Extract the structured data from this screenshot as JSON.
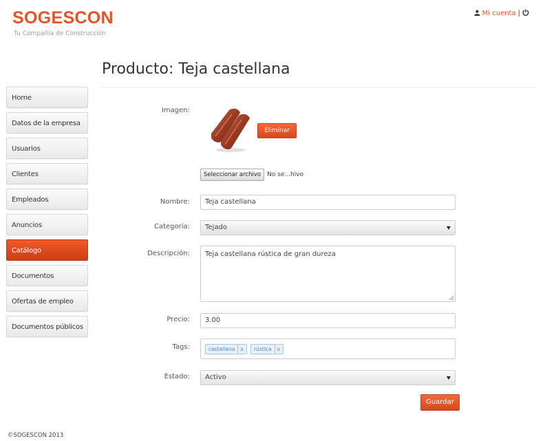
{
  "header": {
    "brand_name": "SOGESCON",
    "brand_tagline": "Tu Compañía de Construcción",
    "account_link": "Mi cuenta",
    "separator": "|"
  },
  "page": {
    "title": "Producto: Teja castellana"
  },
  "sidebar": {
    "items": [
      {
        "label": "Home",
        "active": false
      },
      {
        "label": "Datos de la empresa",
        "active": false
      },
      {
        "label": "Usuarios",
        "active": false
      },
      {
        "label": "Clientes",
        "active": false
      },
      {
        "label": "Empleados",
        "active": false
      },
      {
        "label": "Anuncios",
        "active": false
      },
      {
        "label": "Catálogo",
        "active": true
      },
      {
        "label": "Documentos",
        "active": false
      },
      {
        "label": "Ofertas de empleo",
        "active": false
      },
      {
        "label": "Documentos públicos",
        "active": false
      }
    ]
  },
  "form": {
    "image_label": "Imagen:",
    "delete_button": "Eliminar",
    "file_button": "Seleccionar archivo",
    "file_status": "No se...hivo",
    "name_label": "Nombre:",
    "name_value": "Teja castellana",
    "category_label": "Categoría:",
    "category_value": "Tejado",
    "description_label": "Descripción:",
    "description_value": "Teja castellana rústica de gran dureza",
    "price_label": "Precio:",
    "price_value": "3.00",
    "tags_label": "Tags:",
    "tags": [
      "castellana",
      "rústica"
    ],
    "tag_remove": "x",
    "status_label": "Estado:",
    "status_value": "Activo",
    "save_button": "Guardar"
  },
  "footer": {
    "copyright": "©SOGESCON 2013"
  },
  "colors": {
    "accent": "#e5532a",
    "active_nav": "#dd4a1b"
  },
  "icons": {
    "account": "user-icon",
    "logout": "power-icon"
  }
}
